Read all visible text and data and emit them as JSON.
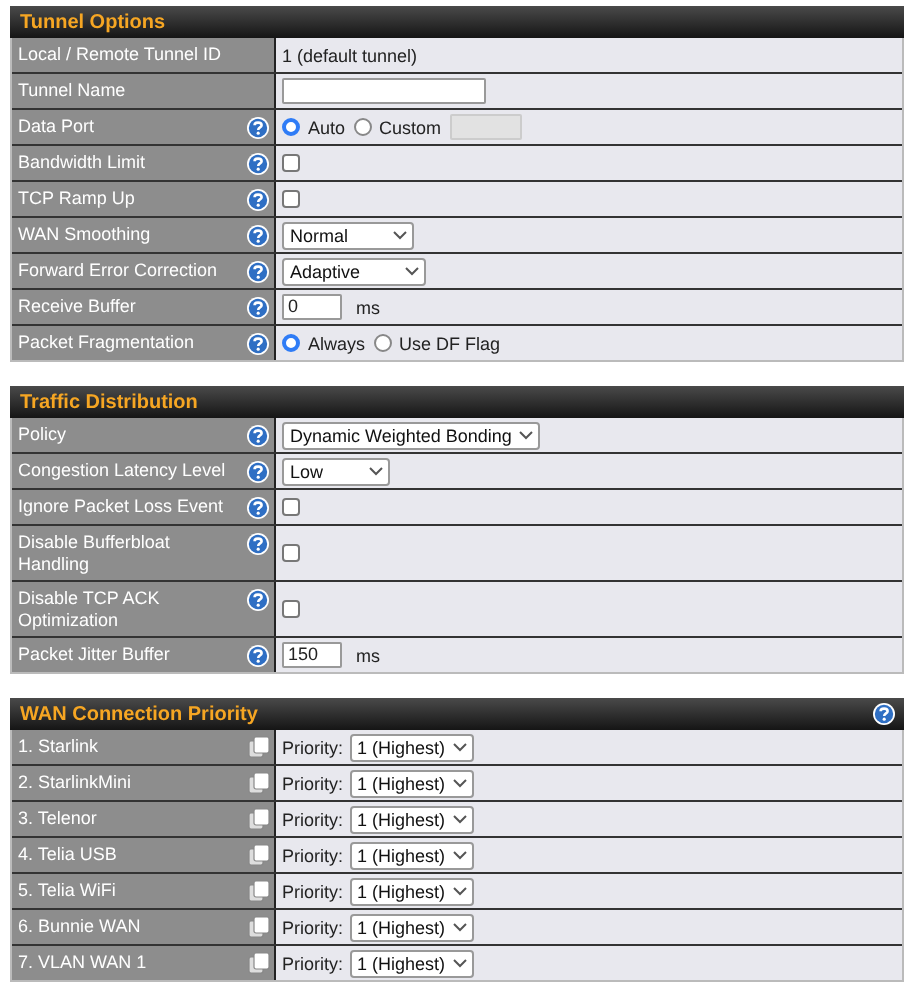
{
  "sections": [
    {
      "title": "Tunnel Options",
      "kind": "settings",
      "header_help": false,
      "rows": [
        {
          "label": "Local / Remote Tunnel ID",
          "help": false,
          "kind": "text",
          "value": "1 (default tunnel)"
        },
        {
          "label": "Tunnel Name",
          "help": false,
          "kind": "input"
        },
        {
          "label": "Data Port",
          "help": true,
          "kind": "radio",
          "options": [
            {
              "label": "Auto",
              "selected": true
            },
            {
              "label": "Custom",
              "selected": false
            }
          ],
          "extra_field": {
            "disabled": true
          }
        },
        {
          "label": "Bandwidth Limit",
          "help": true,
          "kind": "checkbox",
          "checked": false
        },
        {
          "label": "TCP Ramp Up",
          "help": true,
          "kind": "checkbox",
          "checked": false
        },
        {
          "label": "WAN Smoothing",
          "help": true,
          "kind": "select",
          "value": "Normal"
        },
        {
          "label": "Forward Error Correction",
          "help": true,
          "kind": "select",
          "value": "Adaptive"
        },
        {
          "label": "Receive Buffer",
          "help": true,
          "kind": "number",
          "value": "0",
          "unit": "ms"
        },
        {
          "label": "Packet Fragmentation",
          "help": true,
          "kind": "radio",
          "options": [
            {
              "label": "Always",
              "selected": true
            },
            {
              "label": "Use DF Flag",
              "selected": false
            }
          ]
        }
      ]
    },
    {
      "title": "Traffic Distribution",
      "kind": "settings",
      "header_help": false,
      "rows": [
        {
          "label": "Policy",
          "help": true,
          "kind": "select",
          "value": "Dynamic Weighted Bonding"
        },
        {
          "label": "Congestion Latency Level",
          "help": true,
          "kind": "select",
          "value": "Low"
        },
        {
          "label": "Ignore Packet Loss Event",
          "help": true,
          "kind": "checkbox",
          "checked": false
        },
        {
          "label": "Disable Bufferbloat Handling",
          "help": true,
          "kind": "checkbox",
          "checked": false
        },
        {
          "label": "Disable TCP ACK Optimization",
          "help": true,
          "kind": "checkbox",
          "checked": false
        },
        {
          "label": "Packet Jitter Buffer",
          "help": true,
          "kind": "number",
          "value": "150",
          "unit": "ms"
        }
      ]
    },
    {
      "title": "WAN Connection Priority",
      "kind": "priority",
      "header_help": true,
      "rows": [
        {
          "label": "1. Starlink",
          "prefix": "Priority:",
          "value": "1 (Highest)"
        },
        {
          "label": "2. StarlinkMini",
          "prefix": "Priority:",
          "value": "1 (Highest)"
        },
        {
          "label": "3. Telenor",
          "prefix": "Priority:",
          "value": "1 (Highest)"
        },
        {
          "label": "4. Telia USB",
          "prefix": "Priority:",
          "value": "1 (Highest)"
        },
        {
          "label": "5. Telia WiFi",
          "prefix": "Priority:",
          "value": "1 (Highest)"
        },
        {
          "label": "6. Bunnie WAN",
          "prefix": "Priority:",
          "value": "1 (Highest)"
        },
        {
          "label": "7. VLAN WAN 1",
          "prefix": "Priority:",
          "value": "1 (Highest)"
        }
      ]
    }
  ]
}
